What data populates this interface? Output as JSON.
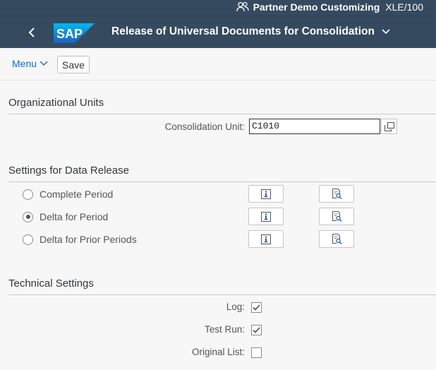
{
  "shell": {
    "system_name": "Partner Demo Customizing",
    "system_client": "XLE/100",
    "title": "Release of Universal Documents for Consolidation",
    "logo_text": "SAP"
  },
  "toolbar": {
    "menu_label": "Menu",
    "save_label": "Save"
  },
  "org_units": {
    "title": "Organizational Units",
    "consolidation_unit_label": "Consolidation Unit:",
    "consolidation_unit_value": "C1010"
  },
  "data_release": {
    "title": "Settings for Data Release",
    "options": [
      {
        "label": "Complete Period",
        "selected": false
      },
      {
        "label": "Delta for Period",
        "selected": true
      },
      {
        "label": "Delta for Prior Periods",
        "selected": false
      }
    ]
  },
  "technical": {
    "title": "Technical Settings",
    "log_label": "Log:",
    "log_checked": true,
    "test_run_label": "Test Run:",
    "test_run_checked": true,
    "original_list_label": "Original List:",
    "original_list_checked": false
  },
  "colors": {
    "shell_bg": "#354a5f",
    "link_blue": "#0a6ed1",
    "page_bg": "#f7f7f7"
  }
}
